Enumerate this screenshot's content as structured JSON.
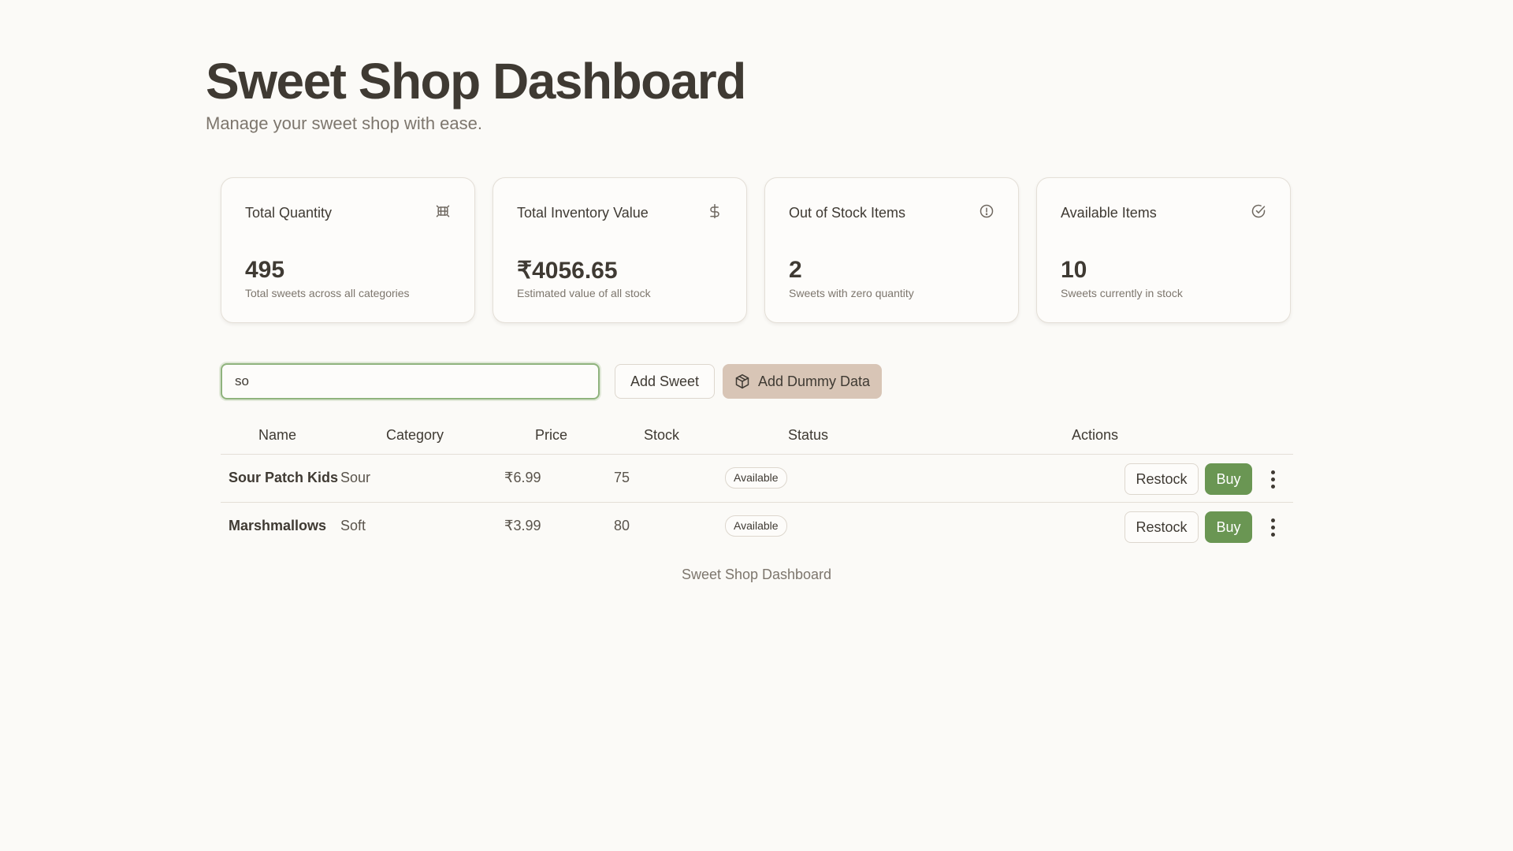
{
  "header": {
    "title": "Sweet Shop Dashboard",
    "subtitle": "Manage your sweet shop with ease."
  },
  "stats": [
    {
      "title": "Total Quantity",
      "value": "495",
      "description": "Total sweets across all categories",
      "icon": "candy-icon"
    },
    {
      "title": "Total Inventory Value",
      "value": "₹4056.65",
      "description": "Estimated value of all stock",
      "icon": "dollar-icon"
    },
    {
      "title": "Out of Stock Items",
      "value": "2",
      "description": "Sweets with zero quantity",
      "icon": "alert-circle-icon"
    },
    {
      "title": "Available Items",
      "value": "10",
      "description": "Sweets currently in stock",
      "icon": "check-circle-icon"
    }
  ],
  "toolbar": {
    "search_value": "so",
    "add_sweet_label": "Add Sweet",
    "add_dummy_label": "Add Dummy Data"
  },
  "table": {
    "headers": {
      "name": "Name",
      "category": "Category",
      "price": "Price",
      "stock": "Stock",
      "status": "Status",
      "actions": "Actions"
    },
    "rows": [
      {
        "name": "Sour Patch Kids",
        "category": "Sour",
        "price": "₹6.99",
        "stock": "75",
        "status": "Available",
        "restock_label": "Restock",
        "buy_label": "Buy"
      },
      {
        "name": "Marshmallows",
        "category": "Soft",
        "price": "₹3.99",
        "stock": "80",
        "status": "Available",
        "restock_label": "Restock",
        "buy_label": "Buy"
      }
    ]
  },
  "footer": {
    "text": "Sweet Shop Dashboard"
  },
  "colors": {
    "background": "#fbfaf7",
    "text": "#3f3a33",
    "muted": "#7d766d",
    "buy_button": "#6a9653",
    "dummy_button": "#d8c5b6",
    "search_focus": "#8fb37d"
  }
}
